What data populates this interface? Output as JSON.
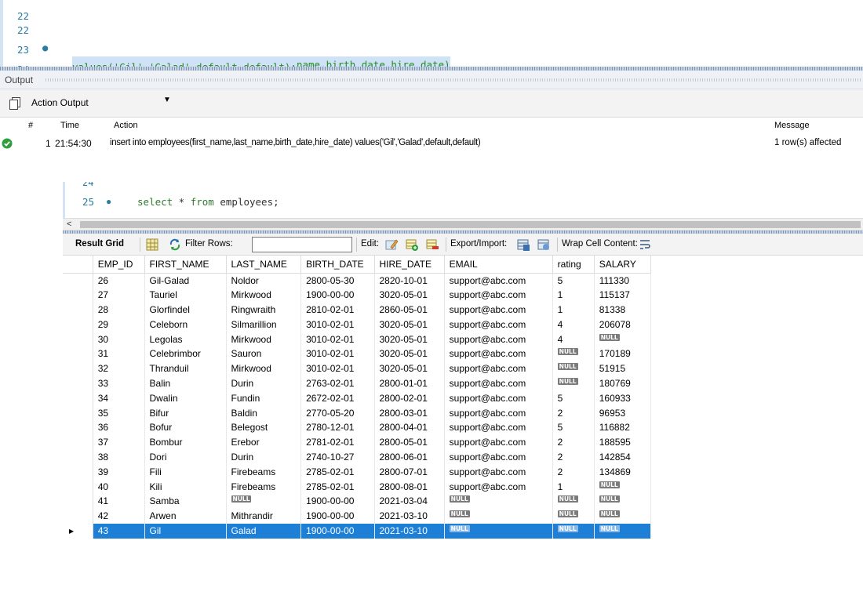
{
  "editor_top": {
    "partial_line": "22",
    "lines": [
      {
        "num": "22",
        "dot": "●",
        "text": "insert into employees(first_name,last_name,birth_date,hire_date)"
      },
      {
        "num": "23",
        "dot": "",
        "text": "values('Gil','Galad',default,default);"
      },
      {
        "num": "24",
        "dot": "",
        "text": ""
      }
    ]
  },
  "output": {
    "header_label": "Output",
    "dropdown_value": "Action Output",
    "columns": {
      "num": "#",
      "time": "Time",
      "action": "Action",
      "message": "Message"
    },
    "rows": [
      {
        "num": "1",
        "time": "21:54:30",
        "action": "insert into employees(first_name,last_name,birth_date,hire_date) values('Gil','Galad',default,default)",
        "message": "1 row(s) affected"
      }
    ]
  },
  "editor2": {
    "partial_line": "24",
    "line_num": "25",
    "dot": "●",
    "code_kw1": "select",
    "code_mid": " * ",
    "code_kw2": "from",
    "code_rest": " employees;"
  },
  "toolbar": {
    "result_grid": "Result Grid",
    "filter_rows": "Filter Rows:",
    "edit": "Edit:",
    "export_import": "Export/Import:",
    "wrap_cell": "Wrap Cell Content:"
  },
  "grid": {
    "columns": [
      "EMP_ID",
      "FIRST_NAME",
      "LAST_NAME",
      "BIRTH_DATE",
      "HIRE_DATE",
      "EMAIL",
      "rating",
      "SALARY"
    ],
    "null_label": "NULL",
    "rows": [
      [
        "26",
        "Gil-Galad",
        "Noldor",
        "2800-05-30",
        "2820-10-01",
        "support@abc.com",
        "5",
        "111330"
      ],
      [
        "27",
        "Tauriel",
        "Mirkwood",
        "1900-00-00",
        "3020-05-01",
        "support@abc.com",
        "1",
        "115137"
      ],
      [
        "28",
        "Glorfindel",
        "Ringwraith",
        "2810-02-01",
        "2860-05-01",
        "support@abc.com",
        "1",
        "81338"
      ],
      [
        "29",
        "Celeborn",
        "Silmarillion",
        "3010-02-01",
        "3020-05-01",
        "support@abc.com",
        "4",
        "206078"
      ],
      [
        "30",
        "Legolas",
        "Mirkwood",
        "3010-02-01",
        "3020-05-01",
        "support@abc.com",
        "4",
        null
      ],
      [
        "31",
        "Celebrimbor",
        "Sauron",
        "3010-02-01",
        "3020-05-01",
        "support@abc.com",
        null,
        "170189"
      ],
      [
        "32",
        "Thranduil",
        "Mirkwood",
        "3010-02-01",
        "3020-05-01",
        "support@abc.com",
        null,
        "51915"
      ],
      [
        "33",
        "Balin",
        "Durin",
        "2763-02-01",
        "2800-01-01",
        "support@abc.com",
        null,
        "180769"
      ],
      [
        "34",
        "Dwalin",
        "Fundin",
        "2672-02-01",
        "2800-02-01",
        "support@abc.com",
        "5",
        "160933"
      ],
      [
        "35",
        "Bifur",
        "Baldin",
        "2770-05-20",
        "2800-03-01",
        "support@abc.com",
        "2",
        "96953"
      ],
      [
        "36",
        "Bofur",
        "Belegost",
        "2780-12-01",
        "2800-04-01",
        "support@abc.com",
        "5",
        "116882"
      ],
      [
        "37",
        "Bombur",
        "Erebor",
        "2781-02-01",
        "2800-05-01",
        "support@abc.com",
        "2",
        "188595"
      ],
      [
        "38",
        "Dori",
        "Durin",
        "2740-10-27",
        "2800-06-01",
        "support@abc.com",
        "2",
        "142854"
      ],
      [
        "39",
        "Fili",
        "Firebeams",
        "2785-02-01",
        "2800-07-01",
        "support@abc.com",
        "2",
        "134869"
      ],
      [
        "40",
        "Kili",
        "Firebeams",
        "2785-02-01",
        "2800-08-01",
        "support@abc.com",
        "1",
        null
      ],
      [
        "41",
        "Samba",
        null,
        "1900-00-00",
        "2021-03-04",
        null,
        null,
        null
      ],
      [
        "42",
        "Arwen",
        "Mithrandir",
        "1900-00-00",
        "2021-03-10",
        null,
        null,
        null
      ],
      [
        "43",
        "Gil",
        "Galad",
        "1900-00-00",
        "2021-03-10",
        null,
        null,
        null
      ]
    ],
    "selected_row_index": 17,
    "row_marker": "▶"
  },
  "colors": {
    "selection": "#1e7fd6",
    "keyword": "#2f7a2f",
    "line_number": "#2b7ca0",
    "highlight": "#cfe2f6"
  }
}
